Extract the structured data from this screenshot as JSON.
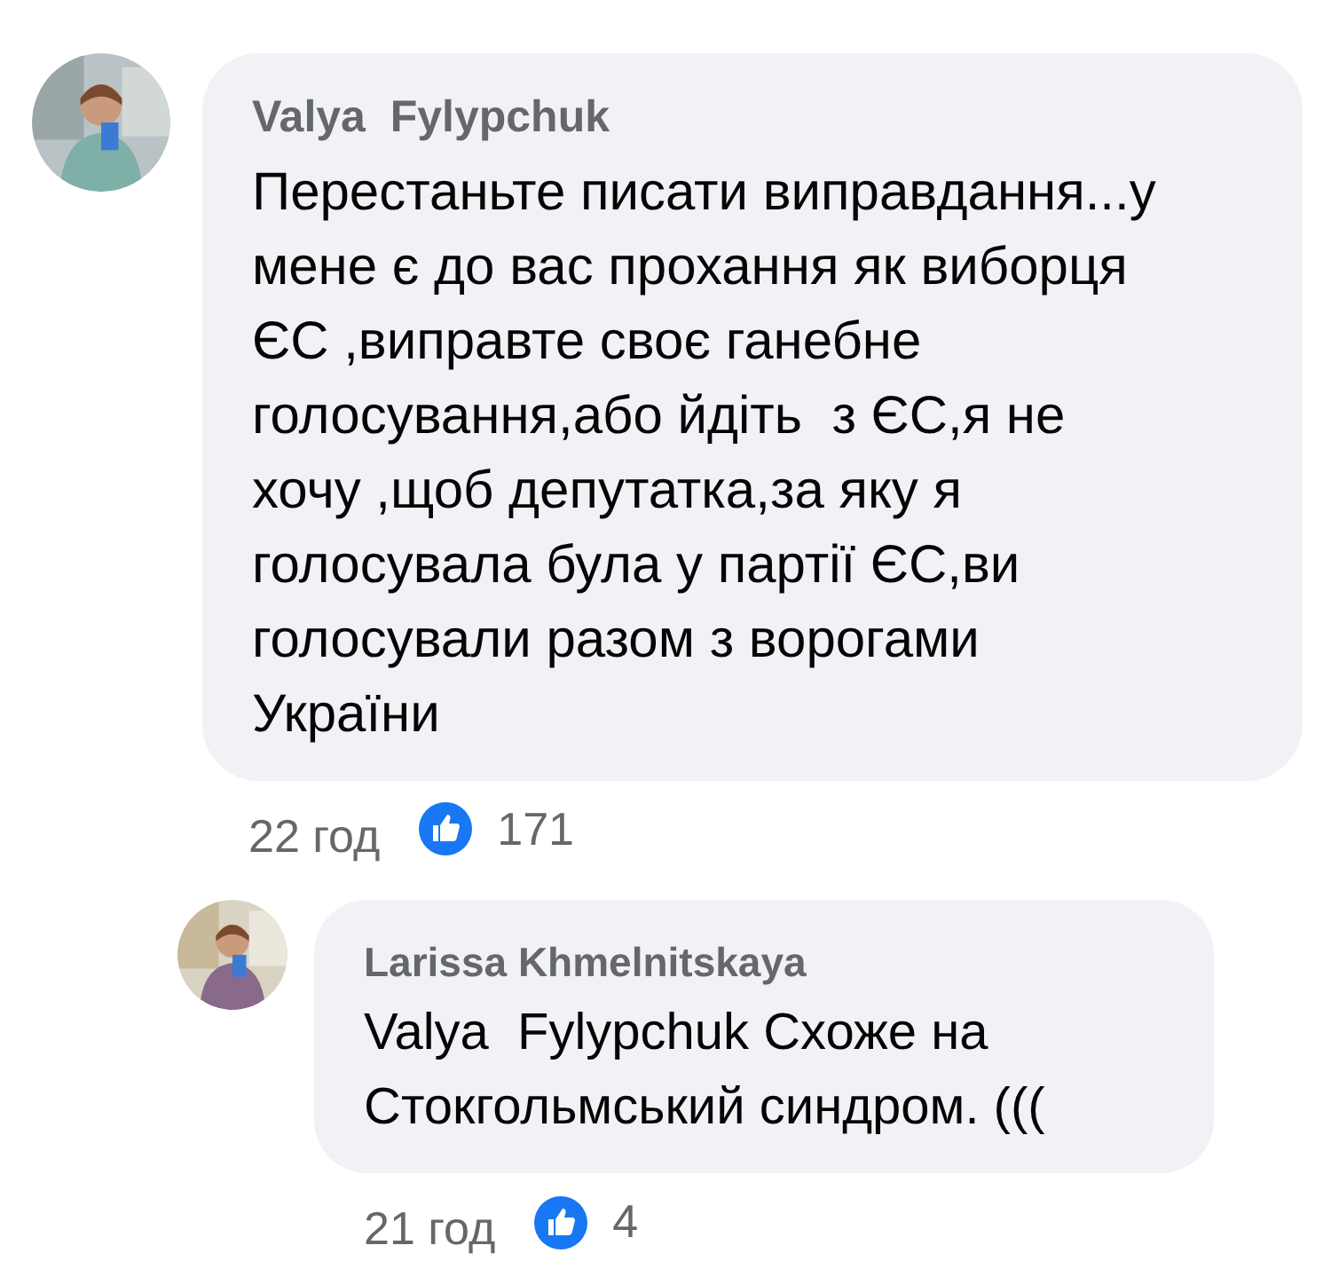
{
  "comments": [
    {
      "author": "Valya  Fylypchuk",
      "text": "Перестаньте писати виправдання...у мене є до вас прохання як виборця ЄС ,виправте своє ганебне голосування,або йдіть  з ЄС,я не хочу ,щоб депутатка,за яку я голосувала була у партії ЄС,ви голосували разом з ворогами України",
      "time": "22 год",
      "reactions": "171",
      "kind": "top"
    },
    {
      "author": "Larissa Khmelnitskaya",
      "text": "Valya  Fylypchuk Схоже на Стокгольмський синдром. (((",
      "time": "21 год",
      "reactions": "4",
      "kind": "reply"
    }
  ]
}
